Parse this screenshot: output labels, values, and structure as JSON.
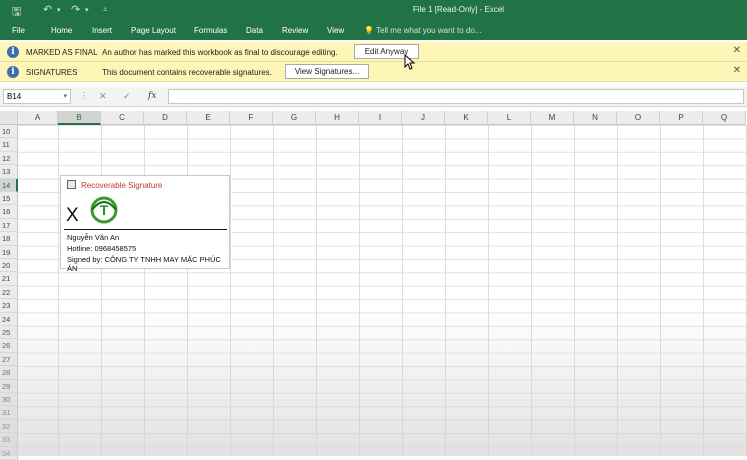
{
  "window": {
    "title": "File 1  [Read-Only] - Excel"
  },
  "quick_access": {
    "save_icon": "save-icon",
    "undo_icon": "undo-icon",
    "redo_icon": "redo-icon"
  },
  "ribbon": {
    "tabs": [
      "File",
      "Home",
      "Insert",
      "Page Layout",
      "Formulas",
      "Data",
      "Review",
      "View"
    ],
    "tell_me": "Tell me what you want to do..."
  },
  "banners": [
    {
      "heading": "MARKED AS FINAL",
      "text": "An author has marked this workbook as final to discourage editing.",
      "button": "Edit Anyway"
    },
    {
      "heading": "SIGNATURES",
      "text": "This document contains recoverable signatures.",
      "button": "View Signatures..."
    }
  ],
  "formula_bar": {
    "name_box": "B14",
    "fx": "fx",
    "value": ""
  },
  "columns": [
    "A",
    "B",
    "C",
    "D",
    "E",
    "F",
    "G",
    "H",
    "I",
    "J",
    "K",
    "L",
    "M",
    "N",
    "O",
    "P",
    "Q"
  ],
  "selected_column": "B",
  "rows": [
    "10",
    "11",
    "12",
    "13",
    "14",
    "15",
    "16",
    "17",
    "18",
    "19",
    "20",
    "21",
    "22",
    "23",
    "24",
    "25",
    "26",
    "27",
    "28",
    "29",
    "30",
    "31",
    "32",
    "33",
    "34"
  ],
  "selected_row": "14",
  "signature": {
    "header": "Recoverable Signature",
    "x_mark": "X",
    "logo_letter": "T",
    "signer_name": "Nguyễn Văn An",
    "hotline": "Hotline: 0968458575",
    "signed_by": "Signed by: CÔNG TY TNHH MAY MẶC PHÚC ÁN"
  },
  "colors": {
    "excel_green": "#217346",
    "banner_yellow": "#fdf6b6",
    "signature_header": "#c0392b"
  }
}
